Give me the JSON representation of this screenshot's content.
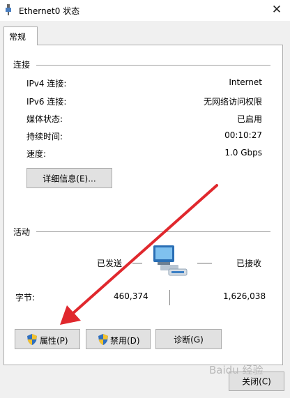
{
  "window": {
    "title": "Ethernet0 状态",
    "close_glyph": "✕"
  },
  "tab": {
    "label": "常规"
  },
  "connection": {
    "heading": "连接",
    "rows": [
      {
        "label": "IPv4 连接:",
        "value": "Internet"
      },
      {
        "label": "IPv6 连接:",
        "value": "无网络访问权限"
      },
      {
        "label": "媒体状态:",
        "value": "已启用"
      },
      {
        "label": "持续时间:",
        "value": "00:10:27"
      },
      {
        "label": "速度:",
        "value": "1.0 Gbps"
      }
    ],
    "details_button": "详细信息(E)..."
  },
  "activity": {
    "heading": "活动",
    "sent_label": "已发送",
    "received_label": "已接收",
    "bytes_label": "字节:",
    "bytes_sent": "460,374",
    "bytes_received": "1,626,038"
  },
  "buttons": {
    "properties": "属性(P)",
    "disable": "禁用(D)",
    "diagnose": "诊断(G)",
    "close": "关闭(C)"
  },
  "icons": {
    "title": "network-adapter-icon",
    "shield": "uac-shield-icon",
    "activity": "network-computers-icon"
  },
  "colors": {
    "annotation_arrow": "#e0282d",
    "shield_blue": "#2f6fbf",
    "shield_yellow": "#f2c12e"
  },
  "watermark": "Baidu 经验"
}
